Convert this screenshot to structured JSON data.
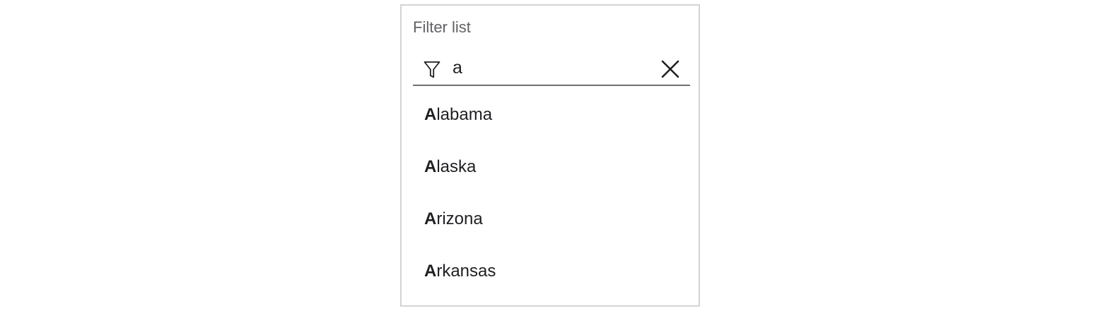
{
  "filter": {
    "label": "Filter list",
    "value": "a",
    "icon": "filter-icon",
    "clear_icon": "close-icon"
  },
  "results": [
    {
      "match": "A",
      "rest": "labama"
    },
    {
      "match": "A",
      "rest": "laska"
    },
    {
      "match": "A",
      "rest": "rizona"
    },
    {
      "match": "A",
      "rest": "rkansas"
    }
  ]
}
